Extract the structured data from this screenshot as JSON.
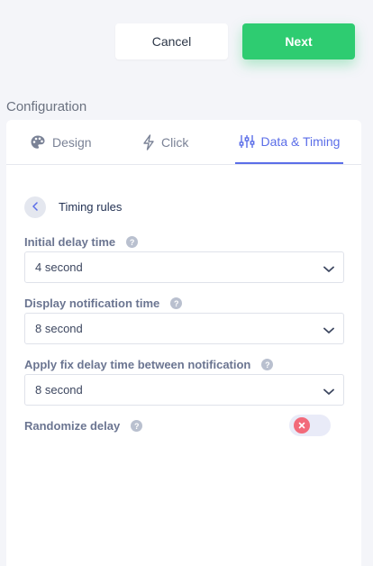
{
  "header": {
    "cancel_label": "Cancel",
    "next_label": "Next"
  },
  "section": {
    "title": "Configuration"
  },
  "tabs": [
    {
      "label": "Design",
      "icon": "palette-icon",
      "active": false
    },
    {
      "label": "Click",
      "icon": "lightning-icon",
      "active": false
    },
    {
      "label": "Data & Timing",
      "icon": "sliders-icon",
      "active": true
    }
  ],
  "timing": {
    "back_label": "Timing rules",
    "initial_delay": {
      "label": "Initial delay time",
      "value": "4 second"
    },
    "display_time": {
      "label": "Display notification time",
      "value": "8 second"
    },
    "fix_delay": {
      "label": "Apply fix delay time between notification",
      "value": "8 second"
    },
    "randomize": {
      "label": "Randomize delay",
      "enabled": false
    }
  },
  "colors": {
    "accent": "#5b6ee8",
    "next_button": "#2ecc71",
    "toggle_off_knob": "#f26a7a"
  }
}
